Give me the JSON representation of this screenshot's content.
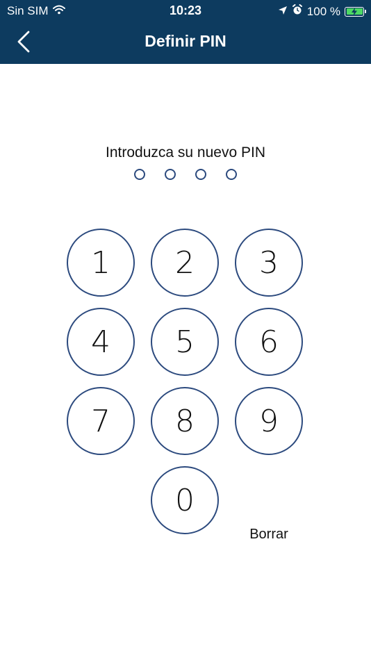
{
  "status_bar": {
    "carrier": "Sin SIM",
    "time": "10:23",
    "battery_percent": "100 %",
    "battery_level": 1.0
  },
  "nav": {
    "title": "Definir PIN"
  },
  "pin": {
    "prompt": "Introduzca su nuevo PIN",
    "entered": 0,
    "length": 4
  },
  "keypad": {
    "keys": [
      "1",
      "2",
      "3",
      "4",
      "5",
      "6",
      "7",
      "8",
      "9",
      "0"
    ],
    "clear_label": "Borrar"
  },
  "colors": {
    "header": "#0d3b5f",
    "key_border": "#2c4a7e",
    "battery_fill": "#4cd964"
  },
  "icons": {
    "back": "chevron-left-icon",
    "wifi": "wifi-icon",
    "location": "location-arrow-icon",
    "alarm": "alarm-icon",
    "battery": "battery-charging-icon"
  }
}
